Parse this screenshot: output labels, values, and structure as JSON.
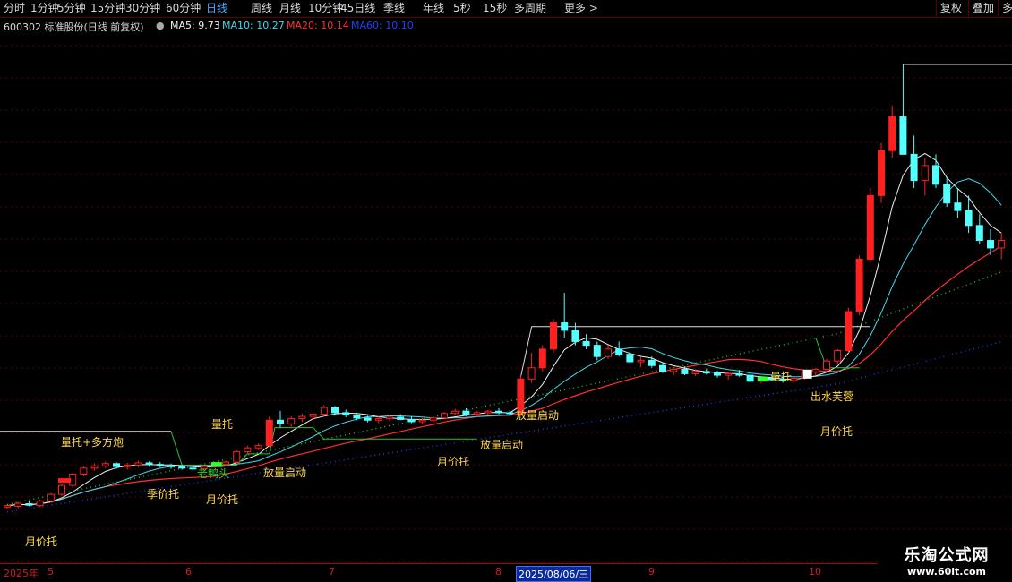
{
  "toolbar": {
    "periods": [
      "分时",
      "1分钟",
      "5分钟",
      "15分钟",
      "30分钟",
      "60分钟",
      "日线",
      "周线",
      "月线",
      "10分钟",
      "45日线",
      "季线",
      "年线",
      "5秒",
      "15秒",
      "多周期",
      "更多 >"
    ],
    "active_index": 6,
    "right_buttons": [
      "复权",
      "叠加",
      "多"
    ]
  },
  "info": {
    "title": "600302 标准股份(日线 前复权)",
    "ma": [
      {
        "label": "MA5: 9.73",
        "color": "#f0f0f0"
      },
      {
        "label": "MA10: 10.27",
        "color": "#40d8f0"
      },
      {
        "label": "MA20: 10.14",
        "color": "#ff3030"
      },
      {
        "label": "MA60: 10.10",
        "color": "#2040ff"
      }
    ]
  },
  "axis": {
    "dates": [
      "2025年",
      "5",
      "6",
      "7",
      "8",
      "9",
      "10"
    ],
    "selected_date": "2025/08/06/三"
  },
  "watermark": {
    "title": "乐淘公式网",
    "url": "www.60lt.com"
  },
  "colors": {
    "up": "#ff2020",
    "down": "#54ffff",
    "ma5": "#f0f0f0",
    "ma10": "#40d8f0",
    "ma20": "#ff3030",
    "ma60": "#2040ff",
    "support": "#30c030",
    "ceiling": "#e0e0e0"
  },
  "chart_data": {
    "type": "candlestick",
    "series_names": [
      "MA5",
      "MA10",
      "MA20",
      "MA60"
    ],
    "ohlc_estimated": [
      [
        6.88,
        6.95,
        6.82,
        6.92
      ],
      [
        6.9,
        7.02,
        6.85,
        6.98
      ],
      [
        6.97,
        7.05,
        6.9,
        6.93
      ],
      [
        6.92,
        7.08,
        6.88,
        7.04
      ],
      [
        7.04,
        7.25,
        7.0,
        7.22
      ],
      [
        7.22,
        7.5,
        7.18,
        7.46
      ],
      [
        7.46,
        7.8,
        7.4,
        7.76
      ],
      [
        7.76,
        7.98,
        7.7,
        7.92
      ],
      [
        7.92,
        8.05,
        7.85,
        7.98
      ],
      [
        7.98,
        8.1,
        7.92,
        8.04
      ],
      [
        8.04,
        8.08,
        7.9,
        7.96
      ],
      [
        7.96,
        8.06,
        7.88,
        8.0
      ],
      [
        8.0,
        8.12,
        7.94,
        8.06
      ],
      [
        8.06,
        8.1,
        7.96,
        8.02
      ],
      [
        8.02,
        8.08,
        7.94,
        7.98
      ],
      [
        7.98,
        8.04,
        7.9,
        7.96
      ],
      [
        7.96,
        8.02,
        7.88,
        7.92
      ],
      [
        7.92,
        7.98,
        7.84,
        7.9
      ],
      [
        7.9,
        8.0,
        7.86,
        7.96
      ],
      [
        7.96,
        8.06,
        7.92,
        8.02
      ],
      [
        8.02,
        8.12,
        7.98,
        8.08
      ],
      [
        8.08,
        8.4,
        8.04,
        8.36
      ],
      [
        8.36,
        8.52,
        8.3,
        8.46
      ],
      [
        8.46,
        8.58,
        8.4,
        8.52
      ],
      [
        8.52,
        9.3,
        8.48,
        9.2
      ],
      [
        9.2,
        9.45,
        9.0,
        9.1
      ],
      [
        9.1,
        9.3,
        9.02,
        9.24
      ],
      [
        9.24,
        9.38,
        9.16,
        9.3
      ],
      [
        9.3,
        9.42,
        9.2,
        9.36
      ],
      [
        9.36,
        9.6,
        9.3,
        9.54
      ],
      [
        9.54,
        9.58,
        9.32,
        9.4
      ],
      [
        9.4,
        9.48,
        9.28,
        9.34
      ],
      [
        9.34,
        9.4,
        9.2,
        9.26
      ],
      [
        9.26,
        9.32,
        9.14,
        9.2
      ],
      [
        9.2,
        9.3,
        9.12,
        9.24
      ],
      [
        9.24,
        9.34,
        9.18,
        9.28
      ],
      [
        9.28,
        9.36,
        9.2,
        9.22
      ],
      [
        9.22,
        9.3,
        9.12,
        9.16
      ],
      [
        9.16,
        9.26,
        9.1,
        9.2
      ],
      [
        9.2,
        9.3,
        9.14,
        9.26
      ],
      [
        9.26,
        9.42,
        9.22,
        9.38
      ],
      [
        9.38,
        9.5,
        9.32,
        9.44
      ],
      [
        9.44,
        9.52,
        9.3,
        9.36
      ],
      [
        9.36,
        9.44,
        9.28,
        9.4
      ],
      [
        9.4,
        9.48,
        9.34,
        9.44
      ],
      [
        9.44,
        9.52,
        9.36,
        9.4
      ],
      [
        9.4,
        9.46,
        9.32,
        9.38
      ],
      [
        9.38,
        10.4,
        9.34,
        10.3
      ],
      [
        10.3,
        11.0,
        10.2,
        10.6
      ],
      [
        10.6,
        11.2,
        10.5,
        11.1
      ],
      [
        11.1,
        11.9,
        11.0,
        11.8
      ],
      [
        11.8,
        12.6,
        11.4,
        11.6
      ],
      [
        11.6,
        11.8,
        11.2,
        11.3
      ],
      [
        11.3,
        11.5,
        11.1,
        11.2
      ],
      [
        11.2,
        11.3,
        10.8,
        10.9
      ],
      [
        10.9,
        11.2,
        10.84,
        11.1
      ],
      [
        11.1,
        11.3,
        10.9,
        10.96
      ],
      [
        10.96,
        11.04,
        10.7,
        10.76
      ],
      [
        10.76,
        10.88,
        10.62,
        10.8
      ],
      [
        10.8,
        10.9,
        10.6,
        10.66
      ],
      [
        10.66,
        10.74,
        10.46,
        10.5
      ],
      [
        10.5,
        10.6,
        10.4,
        10.56
      ],
      [
        10.56,
        10.64,
        10.4,
        10.44
      ],
      [
        10.44,
        10.56,
        10.38,
        10.5
      ],
      [
        10.5,
        10.58,
        10.42,
        10.46
      ],
      [
        10.46,
        10.52,
        10.34,
        10.4
      ],
      [
        10.4,
        10.48,
        10.28,
        10.44
      ],
      [
        10.44,
        10.54,
        10.36,
        10.4
      ],
      [
        10.4,
        10.46,
        10.2,
        10.24
      ],
      [
        10.24,
        10.36,
        10.18,
        10.32
      ],
      [
        10.32,
        10.4,
        10.24,
        10.28
      ],
      [
        10.28,
        10.34,
        10.2,
        10.26
      ],
      [
        10.26,
        10.36,
        10.22,
        10.32
      ],
      [
        10.32,
        10.52,
        10.28,
        10.48
      ],
      [
        10.48,
        10.6,
        10.4,
        10.56
      ],
      [
        10.56,
        10.84,
        10.5,
        10.78
      ],
      [
        10.78,
        11.1,
        10.7,
        11.06
      ],
      [
        11.06,
        12.2,
        11.0,
        12.1
      ],
      [
        12.1,
        13.6,
        12.0,
        13.5
      ],
      [
        13.5,
        15.4,
        13.4,
        15.2
      ],
      [
        15.2,
        16.6,
        15.0,
        16.4
      ],
      [
        16.4,
        17.6,
        16.2,
        17.3
      ],
      [
        17.3,
        18.7,
        17.0,
        16.3
      ],
      [
        16.3,
        16.8,
        15.4,
        15.6
      ],
      [
        15.6,
        16.2,
        15.2,
        16.0
      ],
      [
        16.0,
        16.3,
        15.4,
        15.5
      ],
      [
        15.5,
        15.7,
        14.9,
        15.0
      ],
      [
        15.0,
        15.4,
        14.6,
        14.8
      ],
      [
        14.8,
        15.2,
        14.2,
        14.4
      ],
      [
        14.4,
        14.7,
        13.9,
        14.0
      ],
      [
        14.0,
        14.3,
        13.6,
        13.8
      ],
      [
        13.8,
        14.2,
        13.5,
        14.0
      ]
    ],
    "annotations": [
      "量托+多方炮",
      "季价托",
      "月价托",
      "老鸭头",
      "量托",
      "放量启动",
      "月价托",
      "放量启动",
      "放量启动",
      "量托",
      "出水芙蓉",
      "月价托",
      "月价托"
    ]
  }
}
